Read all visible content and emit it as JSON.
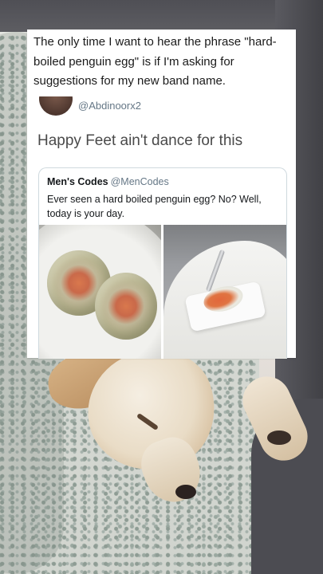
{
  "caption": {
    "lines": [
      "The only time I want to hear the phrase \"hard-",
      "boiled penguin egg\" is if I'm asking for",
      "suggestions for my new band name."
    ]
  },
  "tweet": {
    "handle": "@Abdinoorx2",
    "text": "Happy Feet ain't dance for this"
  },
  "quoted_tweet": {
    "name": "Men's Codes",
    "handle": "@MenCodes",
    "text_lines": [
      "Ever seen a hard boiled penguin egg? No? Well,",
      "today is your day."
    ]
  }
}
